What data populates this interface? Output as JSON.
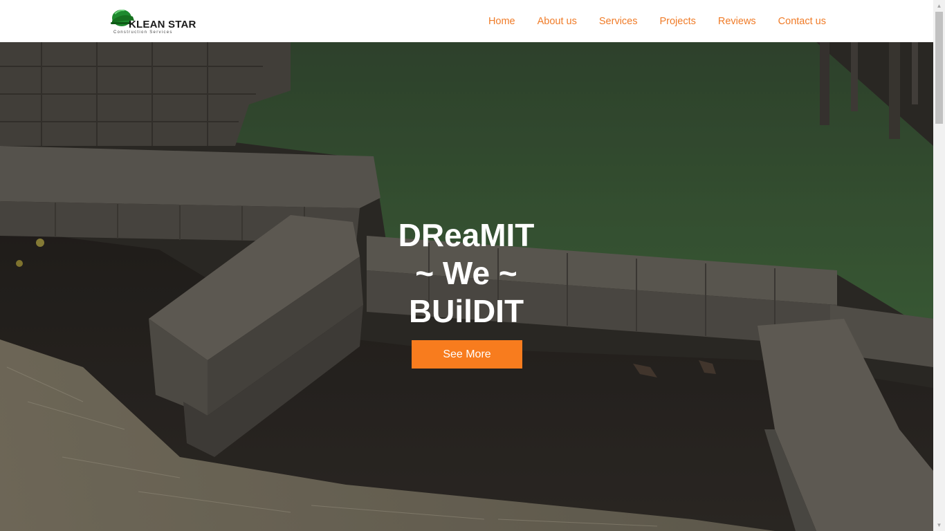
{
  "brand": {
    "name": "KLEAN STAR",
    "tagline": "Construction Services",
    "accent_color": "#f07b27",
    "helmet_color": "#1e8a2e"
  },
  "nav": {
    "items": [
      {
        "label": "Home"
      },
      {
        "label": "About us"
      },
      {
        "label": "Services"
      },
      {
        "label": "Projects"
      },
      {
        "label": "Reviews"
      },
      {
        "label": "Contact us"
      }
    ]
  },
  "hero": {
    "title_lines": [
      "DReaMIT",
      "~ We ~",
      "BUilDIT"
    ],
    "cta_label": "See More",
    "cta_color": "#f87c1e"
  },
  "scrollbar": {
    "up_icon": "scroll-up-arrow",
    "down_icon": "scroll-down-arrow"
  }
}
